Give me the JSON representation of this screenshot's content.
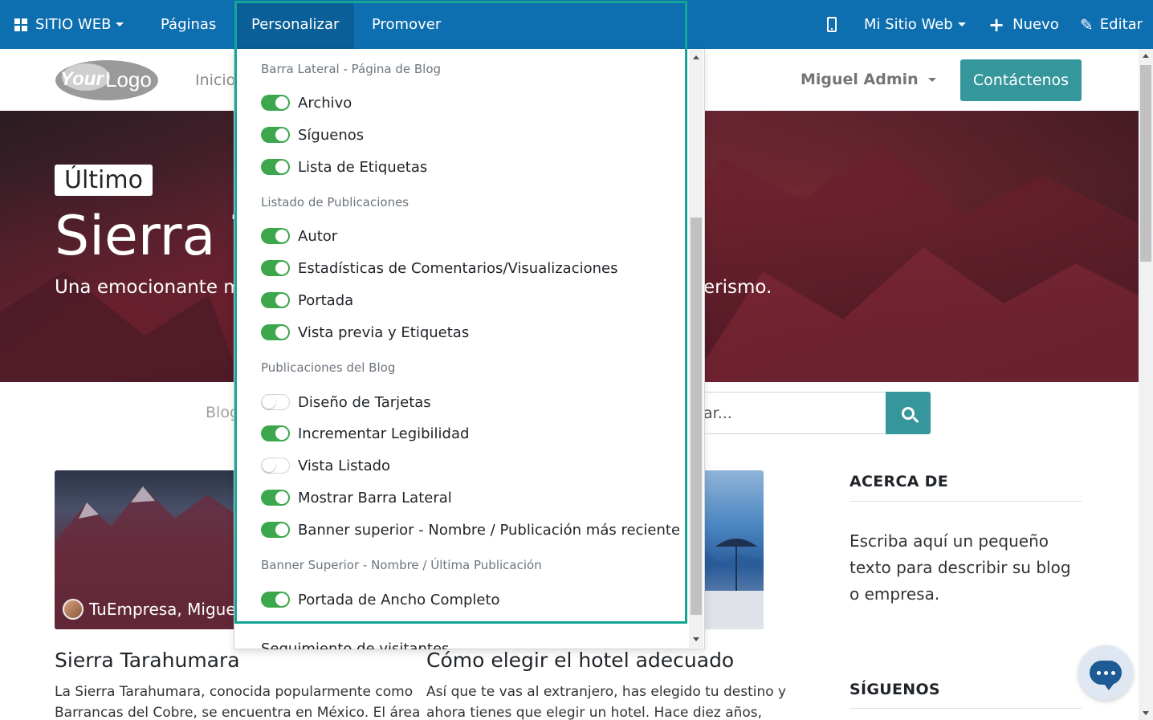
{
  "topbar": {
    "site_menu": "SITIO WEB",
    "pages": "Páginas",
    "customize": "Personalizar",
    "promote": "Promover",
    "my_site": "Mi Sitio Web",
    "new": "Nuevo",
    "edit": "Editar"
  },
  "header": {
    "logo_text": "YourLogo",
    "home": "Inicio",
    "user": "Miguel Admin",
    "contact": "Contáctenos"
  },
  "hero": {
    "badge": "Último",
    "title": "Sierra T",
    "subtitle_left": "Una emocionante m",
    "subtitle_right": "erismo."
  },
  "blog": {
    "crumb": "Blog",
    "search_text": "ar..."
  },
  "customize_menu": {
    "sections": [
      {
        "label": "Barra Lateral - Página de Blog",
        "options": [
          {
            "label": "Archivo",
            "enabled": true
          },
          {
            "label": "Síguenos",
            "enabled": true
          },
          {
            "label": "Lista de Etiquetas",
            "enabled": true
          }
        ]
      },
      {
        "label": "Listado de Publicaciones",
        "options": [
          {
            "label": "Autor",
            "enabled": true
          },
          {
            "label": "Estadísticas de Comentarios/Visualizaciones",
            "enabled": true
          },
          {
            "label": "Portada",
            "enabled": true
          },
          {
            "label": "Vista previa y Etiquetas",
            "enabled": true
          }
        ]
      },
      {
        "label": "Publicaciones del Blog",
        "options": [
          {
            "label": "Diseño de Tarjetas",
            "enabled": false
          },
          {
            "label": "Incrementar Legibilidad",
            "enabled": true
          },
          {
            "label": "Vista Listado",
            "enabled": false
          },
          {
            "label": "Mostrar Barra Lateral",
            "enabled": true
          },
          {
            "label": "Banner superior - Nombre / Publicación más reciente",
            "enabled": true
          }
        ]
      },
      {
        "label": "Banner Superior - Nombre / Última Publicación",
        "options": [
          {
            "label": "Portada de Ancho Completo",
            "enabled": true
          }
        ]
      }
    ],
    "partial_option": "Seguimiento de visitantes"
  },
  "posts": [
    {
      "author": "TuEmpresa, Migue",
      "title": "Sierra Tarahumara",
      "excerpt_line1": "La Sierra Tarahumara, conocida popularmente como",
      "excerpt_line2": "Barrancas del Cobre, se encuentra en México. El área"
    },
    {
      "title": "Cómo elegir el hotel adecuado",
      "excerpt_line1": "Así que te vas al extranjero, has elegido tu destino y",
      "excerpt_line2": "ahora tienes que elegir un hotel. Hace diez años,"
    }
  ],
  "sidebar": {
    "about_heading": "ACERCA DE",
    "about_text": "Escriba aquí un pequeño texto para describir su blog o empresa.",
    "follow_heading": "SÍGUENOS"
  },
  "colors": {
    "admin_bar": "#0e6fb0",
    "accent_teal": "#35979c",
    "toggle_on": "#3ca74c",
    "highlight_frame": "#14a595"
  }
}
